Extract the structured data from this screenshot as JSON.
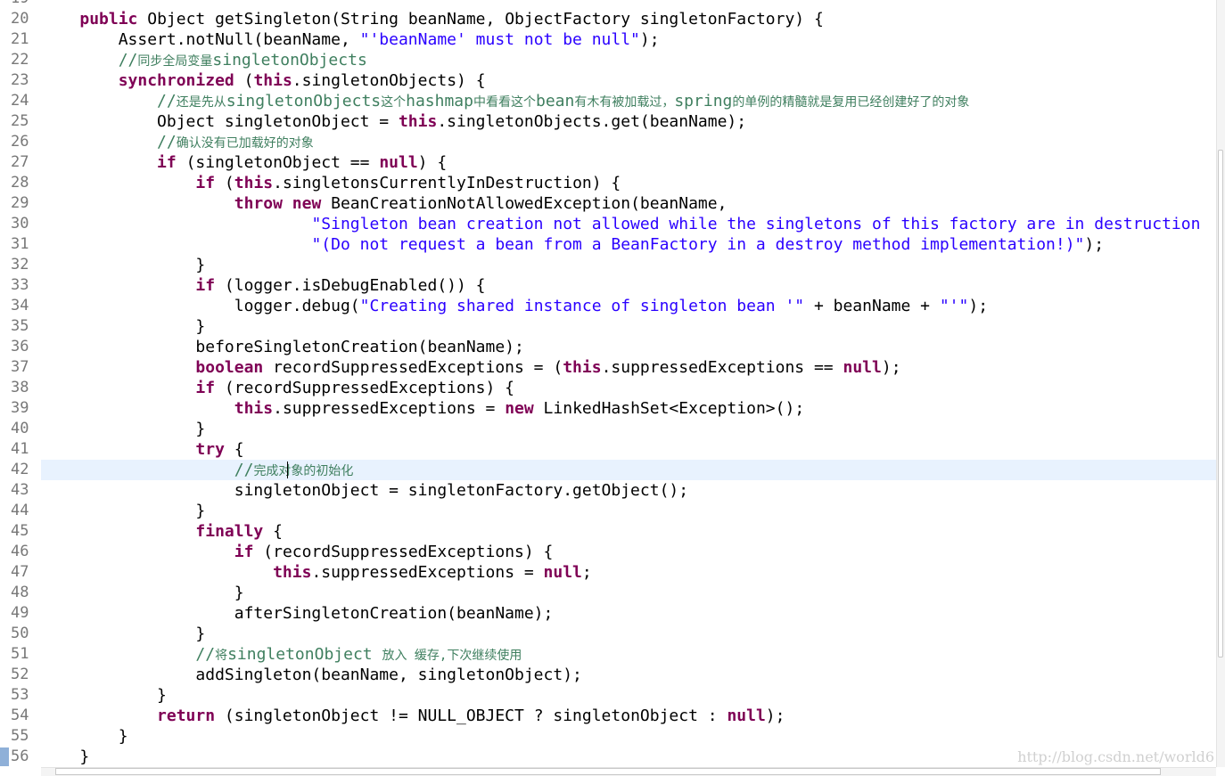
{
  "editor": {
    "first_line_partial": "19",
    "lines": [
      {
        "num": "20",
        "tokens": [
          [
            "p",
            "    "
          ],
          [
            "k",
            "public"
          ],
          [
            "p",
            " Object getSingleton(String beanName, ObjectFactory singletonFactory) {"
          ]
        ]
      },
      {
        "num": "21",
        "tokens": [
          [
            "p",
            "        Assert.notNull(beanName, "
          ],
          [
            "s",
            "\"'beanName' must not be null\""
          ],
          [
            "p",
            ");"
          ]
        ]
      },
      {
        "num": "22",
        "tokens": [
          [
            "p",
            "        "
          ],
          [
            "c",
            "//"
          ],
          [
            "cc",
            "同步全局变量"
          ],
          [
            "c",
            "singletonObjects"
          ]
        ]
      },
      {
        "num": "23",
        "tokens": [
          [
            "p",
            "        "
          ],
          [
            "k",
            "synchronized"
          ],
          [
            "p",
            " ("
          ],
          [
            "k",
            "this"
          ],
          [
            "p",
            ".singletonObjects) {"
          ]
        ]
      },
      {
        "num": "24",
        "tokens": [
          [
            "p",
            "            "
          ],
          [
            "c",
            "//"
          ],
          [
            "cc",
            "还是先从"
          ],
          [
            "c",
            "singletonObjects"
          ],
          [
            "cc",
            "这个"
          ],
          [
            "c",
            "hashmap"
          ],
          [
            "cc",
            "中看看这个"
          ],
          [
            "c",
            "bean"
          ],
          [
            "cc",
            "有木有被加载过，"
          ],
          [
            "c",
            "spring"
          ],
          [
            "cc",
            "的单例的精髓就是复用已经创建好了的对象"
          ]
        ]
      },
      {
        "num": "25",
        "tokens": [
          [
            "p",
            "            Object singletonObject = "
          ],
          [
            "k",
            "this"
          ],
          [
            "p",
            ".singletonObjects.get(beanName);"
          ]
        ]
      },
      {
        "num": "26",
        "tokens": [
          [
            "p",
            "            "
          ],
          [
            "c",
            "//"
          ],
          [
            "cc",
            "确认没有已加载好的对象"
          ]
        ]
      },
      {
        "num": "27",
        "tokens": [
          [
            "p",
            "            "
          ],
          [
            "k",
            "if"
          ],
          [
            "p",
            " (singletonObject == "
          ],
          [
            "k",
            "null"
          ],
          [
            "p",
            ") {"
          ]
        ]
      },
      {
        "num": "28",
        "tokens": [
          [
            "p",
            "                "
          ],
          [
            "k",
            "if"
          ],
          [
            "p",
            " ("
          ],
          [
            "k",
            "this"
          ],
          [
            "p",
            ".singletonsCurrentlyInDestruction) {"
          ]
        ]
      },
      {
        "num": "29",
        "tokens": [
          [
            "p",
            "                    "
          ],
          [
            "k",
            "throw"
          ],
          [
            "p",
            " "
          ],
          [
            "k",
            "new"
          ],
          [
            "p",
            " BeanCreationNotAllowedException(beanName,"
          ]
        ]
      },
      {
        "num": "30",
        "tokens": [
          [
            "p",
            "                            "
          ],
          [
            "s",
            "\"Singleton bean creation not allowed while the singletons of this factory are in destruction"
          ]
        ]
      },
      {
        "num": "31",
        "tokens": [
          [
            "p",
            "                            "
          ],
          [
            "s",
            "\"(Do not request a bean from a BeanFactory in a destroy method implementation!)\""
          ],
          [
            "p",
            ");"
          ]
        ]
      },
      {
        "num": "32",
        "tokens": [
          [
            "p",
            "                }"
          ]
        ]
      },
      {
        "num": "33",
        "tokens": [
          [
            "p",
            "                "
          ],
          [
            "k",
            "if"
          ],
          [
            "p",
            " (logger.isDebugEnabled()) {"
          ]
        ]
      },
      {
        "num": "34",
        "tokens": [
          [
            "p",
            "                    logger.debug("
          ],
          [
            "s",
            "\"Creating shared instance of singleton bean '\""
          ],
          [
            "p",
            " + beanName + "
          ],
          [
            "s",
            "\"'\""
          ],
          [
            "p",
            ");"
          ]
        ]
      },
      {
        "num": "35",
        "tokens": [
          [
            "p",
            "                }"
          ]
        ]
      },
      {
        "num": "36",
        "tokens": [
          [
            "p",
            "                beforeSingletonCreation(beanName);"
          ]
        ]
      },
      {
        "num": "37",
        "tokens": [
          [
            "p",
            "                "
          ],
          [
            "k",
            "boolean"
          ],
          [
            "p",
            " recordSuppressedExceptions = ("
          ],
          [
            "k",
            "this"
          ],
          [
            "p",
            ".suppressedExceptions == "
          ],
          [
            "k",
            "null"
          ],
          [
            "p",
            ");"
          ]
        ]
      },
      {
        "num": "38",
        "tokens": [
          [
            "p",
            "                "
          ],
          [
            "k",
            "if"
          ],
          [
            "p",
            " (recordSuppressedExceptions) {"
          ]
        ]
      },
      {
        "num": "39",
        "tokens": [
          [
            "p",
            "                    "
          ],
          [
            "k",
            "this"
          ],
          [
            "p",
            ".suppressedExceptions = "
          ],
          [
            "k",
            "new"
          ],
          [
            "p",
            " LinkedHashSet<Exception>();"
          ]
        ]
      },
      {
        "num": "40",
        "tokens": [
          [
            "p",
            "                }"
          ]
        ]
      },
      {
        "num": "41",
        "tokens": [
          [
            "p",
            "                "
          ],
          [
            "k",
            "try"
          ],
          [
            "p",
            " {"
          ]
        ]
      },
      {
        "num": "42",
        "tokens": [
          [
            "p",
            "                    "
          ],
          [
            "c",
            "//"
          ],
          [
            "cc",
            "完成对象的初始化"
          ]
        ]
      },
      {
        "num": "43",
        "tokens": [
          [
            "p",
            "                    singletonObject = singletonFactory.getObject();"
          ]
        ]
      },
      {
        "num": "44",
        "tokens": [
          [
            "p",
            "                }"
          ]
        ]
      },
      {
        "num": "45",
        "tokens": [
          [
            "p",
            "                "
          ],
          [
            "k",
            "finally"
          ],
          [
            "p",
            " {"
          ]
        ]
      },
      {
        "num": "46",
        "tokens": [
          [
            "p",
            "                    "
          ],
          [
            "k",
            "if"
          ],
          [
            "p",
            " (recordSuppressedExceptions) {"
          ]
        ]
      },
      {
        "num": "47",
        "tokens": [
          [
            "p",
            "                        "
          ],
          [
            "k",
            "this"
          ],
          [
            "p",
            ".suppressedExceptions = "
          ],
          [
            "k",
            "null"
          ],
          [
            "p",
            ";"
          ]
        ]
      },
      {
        "num": "48",
        "tokens": [
          [
            "p",
            "                    }"
          ]
        ]
      },
      {
        "num": "49",
        "tokens": [
          [
            "p",
            "                    afterSingletonCreation(beanName);"
          ]
        ]
      },
      {
        "num": "50",
        "tokens": [
          [
            "p",
            "                }"
          ]
        ]
      },
      {
        "num": "51",
        "tokens": [
          [
            "p",
            "                "
          ],
          [
            "c",
            "//"
          ],
          [
            "cc",
            "将"
          ],
          [
            "c",
            "singletonObject "
          ],
          [
            "cc",
            "放入 缓存,下次继续使用"
          ]
        ]
      },
      {
        "num": "52",
        "tokens": [
          [
            "p",
            "                addSingleton(beanName, singletonObject);"
          ]
        ]
      },
      {
        "num": "53",
        "tokens": [
          [
            "p",
            "            }"
          ]
        ]
      },
      {
        "num": "54",
        "tokens": [
          [
            "p",
            "            "
          ],
          [
            "k",
            "return"
          ],
          [
            "p",
            " (singletonObject != NULL_OBJECT ? singletonObject : "
          ],
          [
            "k",
            "null"
          ],
          [
            "p",
            ");"
          ]
        ]
      },
      {
        "num": "55",
        "tokens": [
          [
            "p",
            "        }"
          ]
        ]
      },
      {
        "num": "56",
        "tokens": [
          [
            "p",
            "    }"
          ]
        ]
      }
    ],
    "current_line": "42"
  },
  "watermark": "http://blog.csdn.net/world6",
  "colors": {
    "keyword": "#7f0055",
    "string": "#2a00ff",
    "comment": "#3f7f5f",
    "line_number": "#787878",
    "current_line_bg": "#e8f2fe"
  }
}
